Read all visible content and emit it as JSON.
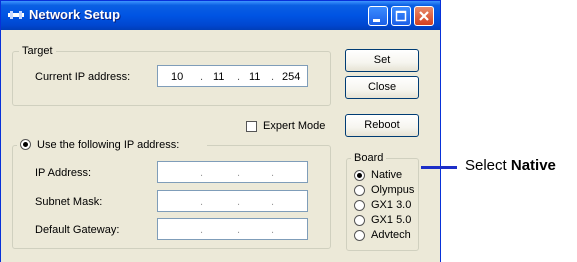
{
  "window": {
    "title": "Network Setup"
  },
  "target": {
    "legend": "Target",
    "current_ip_label": "Current IP address:",
    "current_ip": [
      "10",
      "11",
      "11",
      "254"
    ]
  },
  "expert_mode": {
    "label": "Expert Mode",
    "checked": false
  },
  "use_following": {
    "label": "Use the following IP address:",
    "selected": true,
    "fields": [
      {
        "label": "IP Address:",
        "value": ""
      },
      {
        "label": "Subnet Mask:",
        "value": ""
      },
      {
        "label": "Default Gateway:",
        "value": ""
      }
    ]
  },
  "buttons": {
    "set": "Set",
    "close": "Close",
    "reboot": "Reboot"
  },
  "board": {
    "legend": "Board",
    "options": [
      "Native",
      "Olympus",
      "GX1 3.0",
      "GX1 5.0",
      "Advtech"
    ],
    "selected": "Native"
  },
  "annotation": {
    "prefix": "Select ",
    "emphasis": "Native"
  },
  "colors": {
    "title_bar": "#0054e3",
    "window_bg": "#ece9d8",
    "callout_line": "#1c2ec8"
  }
}
